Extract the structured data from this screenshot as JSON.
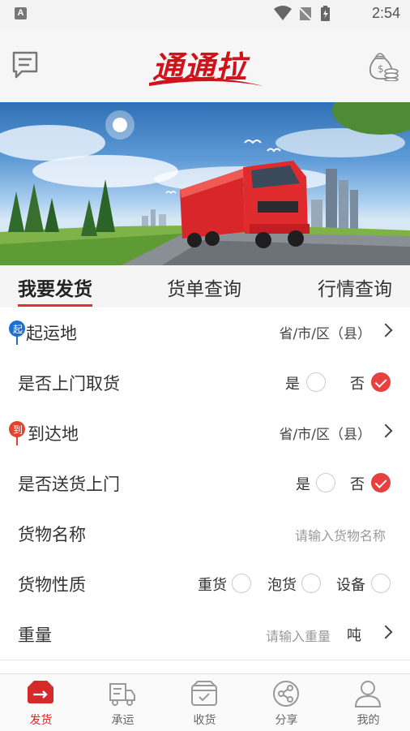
{
  "status_bar": {
    "time": "2:54",
    "notification_letter": "A"
  },
  "header": {
    "logo_text": "通通拉"
  },
  "colors": {
    "accent": "#e6403f",
    "brand_red": "#d0121b",
    "tab_underline": "#e0302f"
  },
  "tabs": [
    {
      "label": "我要发货",
      "active": true
    },
    {
      "label": "货单查询",
      "active": false
    },
    {
      "label": "行情查询",
      "active": false
    }
  ],
  "form": {
    "origin": {
      "label": "起运地",
      "pin_text": "起",
      "value": "省/市/区（县）"
    },
    "pickup": {
      "label": "是否上门取货",
      "yes": "是",
      "no": "否",
      "selected": "否"
    },
    "destination": {
      "label": "到达地",
      "pin_text": "到",
      "value": "省/市/区（县）"
    },
    "delivery": {
      "label": "是否送货上门",
      "yes": "是",
      "no": "否",
      "selected": "否"
    },
    "goods_name": {
      "label": "货物名称",
      "placeholder": "请输入货物名称"
    },
    "goods_type": {
      "label": "货物性质",
      "options": [
        "重货",
        "泡货",
        "设备"
      ]
    },
    "weight": {
      "label": "重量",
      "placeholder": "请输入重量",
      "unit": "吨"
    }
  },
  "bottom_nav": [
    {
      "label": "发货",
      "icon": "ship-out-icon",
      "active": true
    },
    {
      "label": "承运",
      "icon": "truck-icon",
      "active": false
    },
    {
      "label": "收货",
      "icon": "receive-box-icon",
      "active": false
    },
    {
      "label": "分享",
      "icon": "share-icon",
      "active": false
    },
    {
      "label": "我的",
      "icon": "user-icon",
      "active": false
    }
  ]
}
